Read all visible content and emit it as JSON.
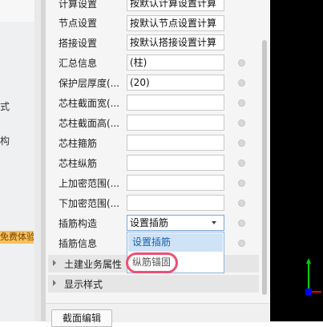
{
  "left_sidebar": {
    "partial_text_1": "式",
    "partial_text_2": "构",
    "promo_badge": "免费体验"
  },
  "properties": [
    {
      "label": "计算设置",
      "value": "按默认计算设置计算"
    },
    {
      "label": "节点设置",
      "value": "按默认节点设置计算"
    },
    {
      "label": "搭接设置",
      "value": "按默认搭接设置计算"
    },
    {
      "label": "汇总信息",
      "value": "(柱)"
    },
    {
      "label": "保护层厚度(...",
      "value": "(20)"
    },
    {
      "label": "芯柱截面宽(...",
      "value": ""
    },
    {
      "label": "芯柱截面高(...",
      "value": ""
    },
    {
      "label": "芯柱箍筋",
      "value": ""
    },
    {
      "label": "芯柱纵筋",
      "value": ""
    },
    {
      "label": "上加密范围(...",
      "value": ""
    },
    {
      "label": "下加密范围(...",
      "value": ""
    },
    {
      "label": "插筋构造",
      "value": "设置插筋"
    },
    {
      "label": "插筋信息",
      "value": ""
    }
  ],
  "dropdown": {
    "options": [
      "设置插筋",
      "纵筋锚固"
    ],
    "selected_index": 0
  },
  "groups": [
    {
      "label": "土建业务属性"
    },
    {
      "label": "显示样式"
    }
  ],
  "bottom_button": "截面编辑",
  "axis_colors": {
    "x": "#ff0000",
    "y": "#00d000",
    "z": "#0000ff"
  }
}
